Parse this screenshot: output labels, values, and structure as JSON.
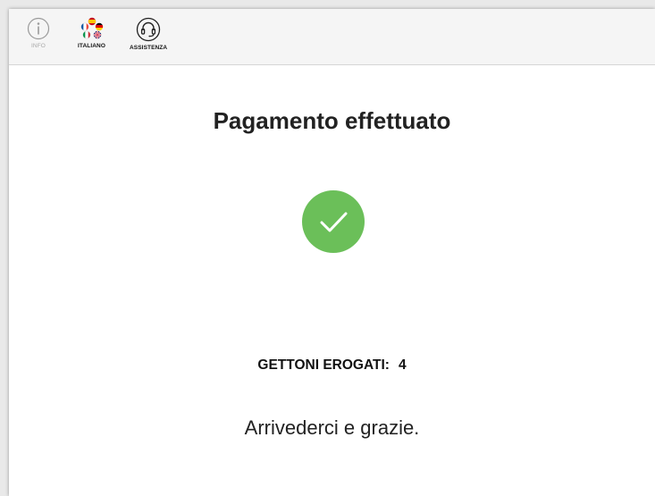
{
  "toolbar": {
    "info_label": "INFO",
    "language_label": "ITALIANO",
    "help_label": "ASSISTENZA"
  },
  "icons": {
    "info": "info-icon",
    "language": "language-flags-icon",
    "help": "headset-icon",
    "success": "check-circle-icon"
  },
  "main": {
    "title": "Pagamento effettuato",
    "tokens_label": "GETTONI EROGATI:",
    "tokens_value": "4",
    "farewell": "Arrivederci e grazie."
  },
  "colors": {
    "success_green": "#6bbf59",
    "toolbar_bg": "#f5f5f5"
  }
}
